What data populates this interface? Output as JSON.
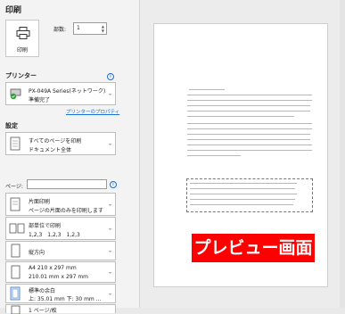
{
  "header": {
    "title": "印刷"
  },
  "print_button": {
    "label": "印刷"
  },
  "copies": {
    "label": "部数:",
    "value": "1"
  },
  "printer": {
    "section_label": "プリンター",
    "name": "PX-049A Series(ネットワーク)...",
    "status": "準備完了",
    "properties_link": "プリンターのプロパティ"
  },
  "settings": {
    "section_label": "設定",
    "pages_label": "ページ:",
    "items": [
      {
        "line1": "すべてのページを印刷",
        "line2": "ドキュメント全体"
      },
      {
        "line1": "片面印刷",
        "line2": "ページの片面のみを印刷します"
      },
      {
        "line1": "部単位で印刷",
        "line2": "1,2,3　1,2,3　1,2,3"
      },
      {
        "line1": "縦方向",
        "line2": ""
      },
      {
        "line1": "A4 210 x 297 mm",
        "line2": "210.01 mm x 297 mm"
      },
      {
        "line1": "標準の余白",
        "line2": "上: 35.01 mm 下: 30 mm ..."
      },
      {
        "line1": "1 ページ/枚",
        "line2": ""
      }
    ]
  },
  "preview": {
    "overlay_text": "プレビュー画面"
  },
  "colors": {
    "accent": "#1a6fd0",
    "overlay": "#ff0000"
  }
}
